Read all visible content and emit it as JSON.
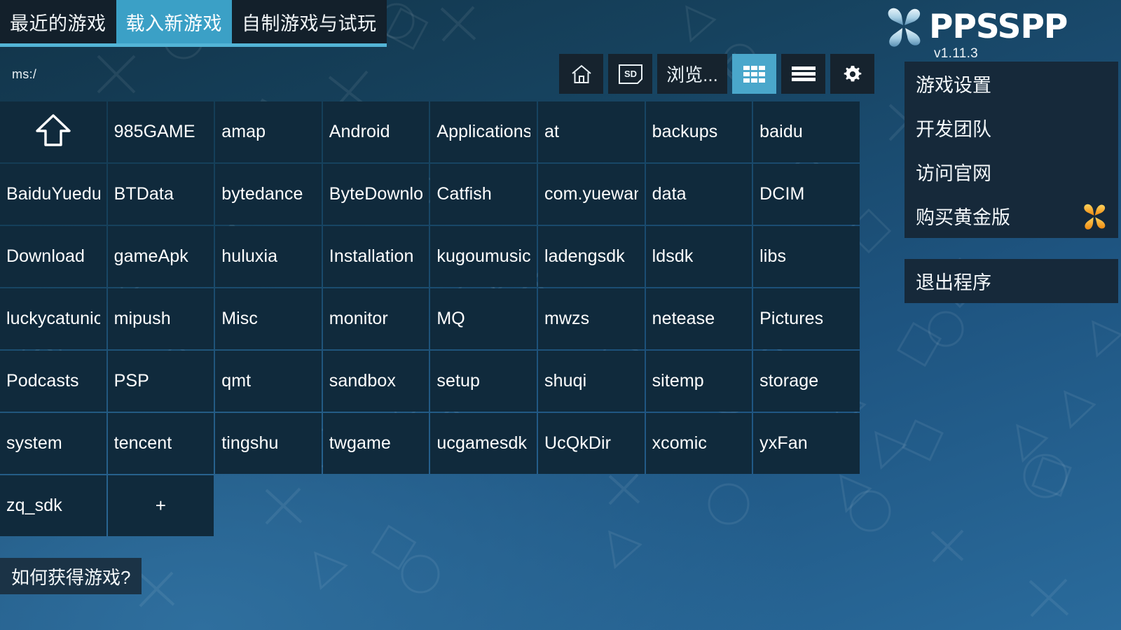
{
  "app": {
    "name": "PPSSPP",
    "version": "v1.11.3",
    "accent_color": "#3ba0c6",
    "underline_color": "#53b4d6",
    "cell_color": "#102a3c",
    "panel_color": "#16293a",
    "gold_color": "#f5a623"
  },
  "tabs": [
    {
      "label": "最近的游戏",
      "active": false,
      "name": "tab-recent-games"
    },
    {
      "label": "载入新游戏",
      "active": true,
      "name": "tab-load-new-game"
    },
    {
      "label": "自制游戏与试玩",
      "active": false,
      "name": "tab-homebrew-demos"
    }
  ],
  "path": {
    "value": "ms:/"
  },
  "toolbar": [
    {
      "name": "home-button",
      "icon": "home-icon",
      "label": "",
      "active": false
    },
    {
      "name": "sd-card-button",
      "icon": "sd-card-icon",
      "label": "",
      "active": false
    },
    {
      "name": "browse-button",
      "icon": "",
      "label": "浏览...",
      "active": false
    },
    {
      "name": "grid-view-button",
      "icon": "grid-view-icon",
      "label": "",
      "active": true
    },
    {
      "name": "list-view-button",
      "icon": "list-view-icon",
      "label": "",
      "active": false
    },
    {
      "name": "settings-button",
      "icon": "gear-icon",
      "label": "",
      "active": false
    }
  ],
  "grid": {
    "columns": 8,
    "items": [
      {
        "label": "",
        "type": "up-directory",
        "icon": "arrow-up-icon"
      },
      {
        "label": "985GAME",
        "type": "folder"
      },
      {
        "label": "amap",
        "type": "folder"
      },
      {
        "label": "Android",
        "type": "folder"
      },
      {
        "label": "Applications",
        "type": "folder"
      },
      {
        "label": "at",
        "type": "folder"
      },
      {
        "label": "backups",
        "type": "folder"
      },
      {
        "label": "baidu",
        "type": "folder"
      },
      {
        "label": "BaiduYuedu",
        "type": "folder"
      },
      {
        "label": "BTData",
        "type": "folder"
      },
      {
        "label": "bytedance",
        "type": "folder"
      },
      {
        "label": "ByteDownloa",
        "type": "folder"
      },
      {
        "label": "Catfish",
        "type": "folder"
      },
      {
        "label": "com.yuewan.",
        "type": "folder"
      },
      {
        "label": "data",
        "type": "folder"
      },
      {
        "label": "DCIM",
        "type": "folder"
      },
      {
        "label": "Download",
        "type": "folder"
      },
      {
        "label": "gameApk",
        "type": "folder"
      },
      {
        "label": "huluxia",
        "type": "folder"
      },
      {
        "label": "Installation",
        "type": "folder"
      },
      {
        "label": "kugoumusic",
        "type": "folder"
      },
      {
        "label": "ladengsdk",
        "type": "folder"
      },
      {
        "label": "ldsdk",
        "type": "folder"
      },
      {
        "label": "libs",
        "type": "folder"
      },
      {
        "label": "luckycatunion",
        "type": "folder"
      },
      {
        "label": "mipush",
        "type": "folder"
      },
      {
        "label": "Misc",
        "type": "folder"
      },
      {
        "label": "monitor",
        "type": "folder"
      },
      {
        "label": "MQ",
        "type": "folder"
      },
      {
        "label": "mwzs",
        "type": "folder"
      },
      {
        "label": "netease",
        "type": "folder"
      },
      {
        "label": "Pictures",
        "type": "folder"
      },
      {
        "label": "Podcasts",
        "type": "folder"
      },
      {
        "label": "PSP",
        "type": "folder"
      },
      {
        "label": "qmt",
        "type": "folder"
      },
      {
        "label": "sandbox",
        "type": "folder"
      },
      {
        "label": "setup",
        "type": "folder"
      },
      {
        "label": "shuqi",
        "type": "folder"
      },
      {
        "label": "sitemp",
        "type": "folder"
      },
      {
        "label": "storage",
        "type": "folder"
      },
      {
        "label": "system",
        "type": "folder"
      },
      {
        "label": "tencent",
        "type": "folder"
      },
      {
        "label": "tingshu",
        "type": "folder"
      },
      {
        "label": "twgame",
        "type": "folder"
      },
      {
        "label": "ucgamesdk",
        "type": "folder"
      },
      {
        "label": "UcQkDir",
        "type": "folder"
      },
      {
        "label": "xcomic",
        "type": "folder"
      },
      {
        "label": "yxFan",
        "type": "folder"
      },
      {
        "label": "zq_sdk",
        "type": "folder"
      },
      {
        "label": "+",
        "type": "add-new"
      }
    ]
  },
  "bottom": {
    "how_to_get_games": "如何获得游戏?"
  },
  "right_menu": {
    "items": [
      {
        "label": "游戏设置",
        "name": "menu-game-settings",
        "badge": ""
      },
      {
        "label": "开发团队",
        "name": "menu-credits",
        "badge": ""
      },
      {
        "label": "访问官网",
        "name": "menu-visit-website",
        "badge": ""
      },
      {
        "label": "购买黄金版",
        "name": "menu-buy-gold",
        "badge": "gold-petal-icon"
      }
    ],
    "exit": {
      "label": "退出程序",
      "name": "menu-exit"
    }
  }
}
